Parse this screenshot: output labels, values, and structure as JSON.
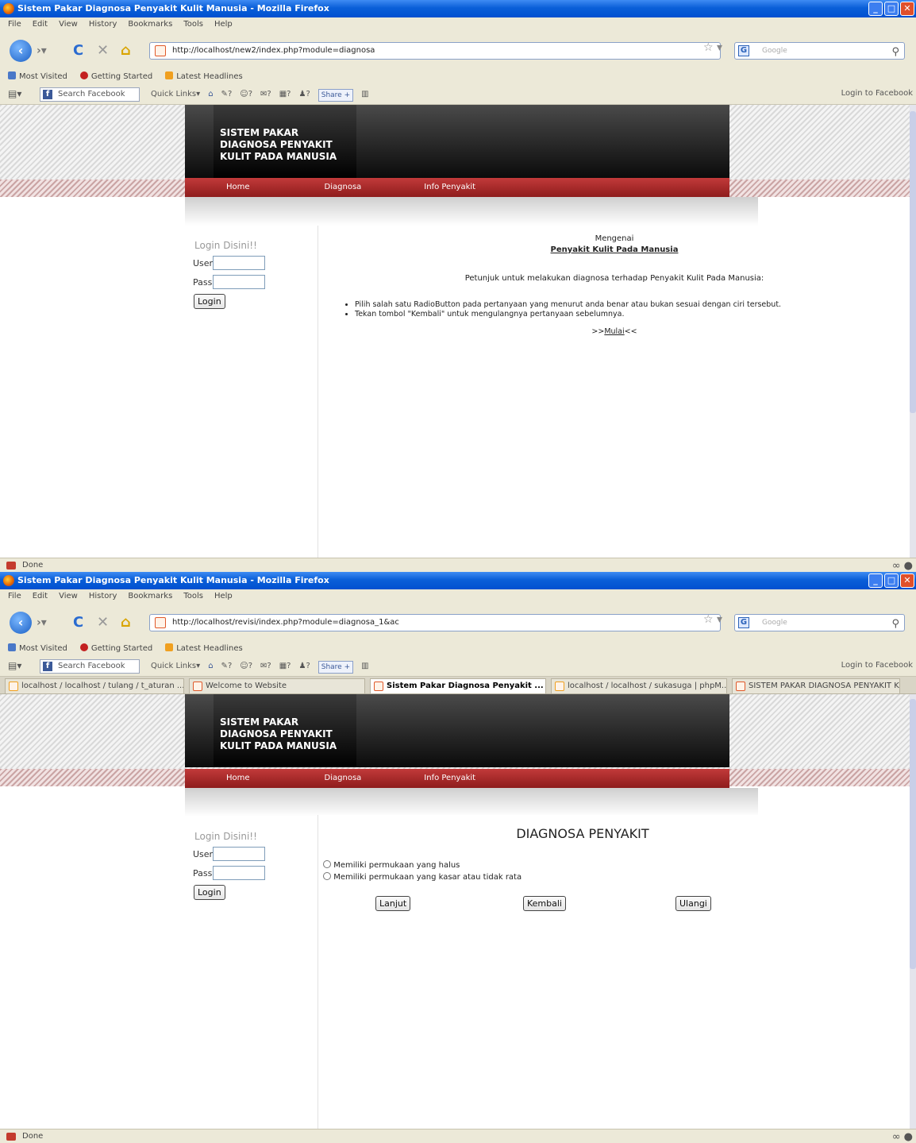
{
  "shared": {
    "window_title": "Sistem Pakar Diagnosa Penyakit Kulit Manusia - Mozilla Firefox",
    "menu": [
      "File",
      "Edit",
      "View",
      "History",
      "Bookmarks",
      "Tools",
      "Help"
    ],
    "search_placeholder": "Google",
    "bookmarks": [
      "Most Visited",
      "Getting Started",
      "Latest Headlines"
    ],
    "facebook": {
      "search_placeholder": "Search Facebook",
      "quick_links": "Quick Links",
      "share": "Share",
      "login": "Login to Facebook",
      "tool_marks": [
        "?",
        "?",
        "?",
        "?",
        "?"
      ]
    },
    "site": {
      "logo": [
        "SISTEM PAKAR",
        "DIAGNOSA PENYAKIT",
        "KULIT PADA MANUSIA"
      ],
      "nav": [
        "Home",
        "Diagnosa",
        "Info Penyakit"
      ]
    },
    "login": {
      "heading": "Login Disini!!",
      "user_label": "User",
      "pass_label": "Pass",
      "button": "Login"
    },
    "status": "Done"
  },
  "screen1": {
    "url": "http://localhost/new2/index.php?module=diagnosa",
    "about_line1": "Mengenai",
    "about_line2": "Penyakit Kulit Pada Manusia",
    "intro": "Petunjuk untuk melakukan diagnosa terhadap Penyakit Kulit Pada Manusia:",
    "bullets": [
      "Pilih salah satu RadioButton pada pertanyaan yang menurut anda benar atau bukan sesuai dengan ciri tersebut.",
      "Tekan tombol \"Kembali\" untuk mengulangnya pertanyaan sebelumnya."
    ],
    "start_prefix": ">>",
    "start_link": "Mulai",
    "start_suffix": "<<"
  },
  "screen2": {
    "url": "http://localhost/revisi/index.php?module=diagnosa_1&ac",
    "tabs": [
      {
        "label": "localhost / localhost / tulang / t_aturan ...",
        "active": false
      },
      {
        "label": "Welcome to Website",
        "active": false
      },
      {
        "label": "Sistem Pakar Diagnosa Penyakit ...",
        "active": true
      },
      {
        "label": "localhost / localhost / sukasuga | phpM...",
        "active": false
      },
      {
        "label": "SISTEM PAKAR DIAGNOSA PENYAKIT K...",
        "active": false
      }
    ],
    "heading": "DIAGNOSA PENYAKIT",
    "options": [
      "Memiliki permukaan yang halus",
      "Memiliki permukaan yang kasar atau tidak rata"
    ],
    "buttons": [
      "Lanjut",
      "Kembali",
      "Ulangi"
    ]
  }
}
